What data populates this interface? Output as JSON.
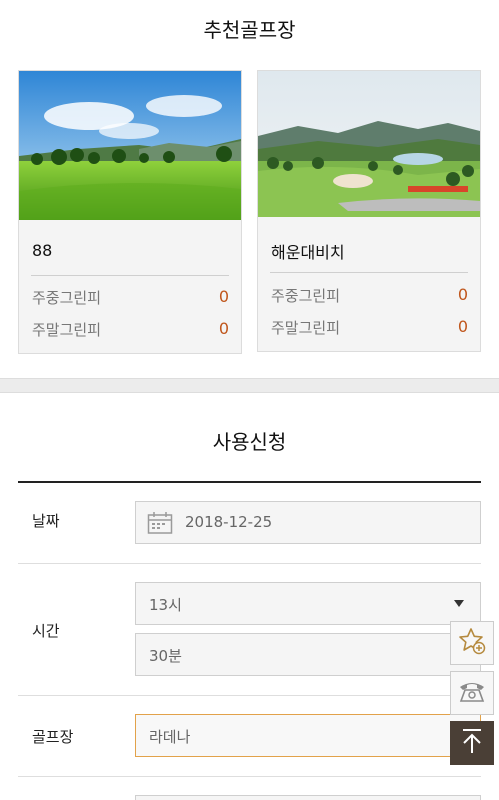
{
  "recommended": {
    "title": "추천골프장",
    "cards": [
      {
        "name": "88",
        "weekday_label": "주중그린피",
        "weekday_value": "0",
        "weekend_label": "주말그린피",
        "weekend_value": "0"
      },
      {
        "name": "해운대비치",
        "weekday_label": "주중그린피",
        "weekday_value": "0",
        "weekend_label": "주말그린피",
        "weekend_value": "0"
      }
    ]
  },
  "application": {
    "title": "사용신청",
    "date": {
      "label": "날짜",
      "value": "2018-12-25"
    },
    "time": {
      "label": "시간",
      "hour": "13시",
      "minute": "30분"
    },
    "course": {
      "label": "골프장",
      "value": "라데나"
    }
  },
  "floating": {
    "favorite_icon": "star-plus-icon",
    "phone_icon": "telephone-icon",
    "top_icon": "arrow-up-icon"
  },
  "colors": {
    "accent": "#c0561c",
    "focus_border": "#e2a24a",
    "top_button": "#4a3f36"
  }
}
